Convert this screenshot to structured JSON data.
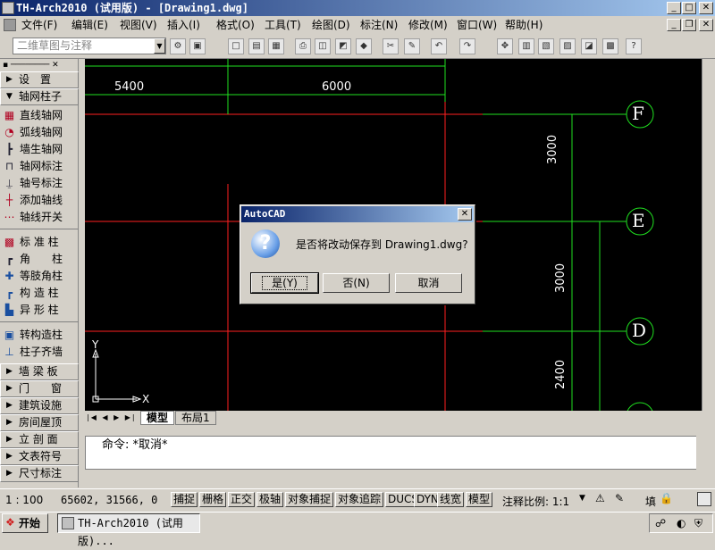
{
  "window": {
    "title": "TH-Arch2010 (试用版) - [Drawing1.dwg]",
    "min": "_",
    "max": "□",
    "close": "✕"
  },
  "menu": [
    "文件(F)",
    "编辑(E)",
    "视图(V)",
    "插入(I)",
    "格式(O)",
    "工具(T)",
    "绘图(D)",
    "标注(N)",
    "修改(M)",
    "窗口(W)",
    "帮助(H)"
  ],
  "toolbar": {
    "workspace": "二维草图与注释"
  },
  "sidebar": {
    "header": "设　置",
    "section": "轴网柱子",
    "items1": [
      "直线轴网",
      "弧线轴网",
      "墙生轴网",
      "轴网标注",
      "轴号标注",
      "添加轴线",
      "轴线开关"
    ],
    "items2": [
      "标 准 柱",
      "角　　柱",
      "等肢角柱",
      "构 造 柱",
      "异 形 柱"
    ],
    "items3": [
      "转构造柱",
      "柱子齐墙"
    ],
    "groups": [
      "墙 梁 板",
      "门　　窗",
      "建筑设施",
      "房间屋顶",
      "立 剖 面",
      "文表符号",
      "尺寸标注"
    ]
  },
  "drawing": {
    "dim_horiz": [
      "5400",
      "6000"
    ],
    "dim_vert": [
      "3000",
      "3000",
      "2400"
    ],
    "axis_labels": [
      "F",
      "E",
      "D"
    ],
    "ucs_x": "X",
    "ucs_y": "Y"
  },
  "tabs": [
    "模型",
    "布局1"
  ],
  "command": {
    "line": "命令: *取消*"
  },
  "status": {
    "scale": "1 : 100",
    "coords": "65602, 31566, 0",
    "buttons": [
      "捕捉",
      "栅格",
      "正交",
      "极轴",
      "对象捕捉",
      "对象追踪",
      "DUCS",
      "DYN",
      "线宽",
      "模型"
    ],
    "annot_label": "注释比例: 1:1",
    "fill": "填"
  },
  "taskbar": {
    "start": "开始",
    "item": "TH-Arch2010 (试用版)..."
  },
  "dialog": {
    "title": "AutoCAD",
    "message": "是否将改动保存到 Drawing1.dwg?",
    "icon": "?",
    "yes": "是(Y)",
    "no": "否(N)",
    "cancel": "取消"
  }
}
